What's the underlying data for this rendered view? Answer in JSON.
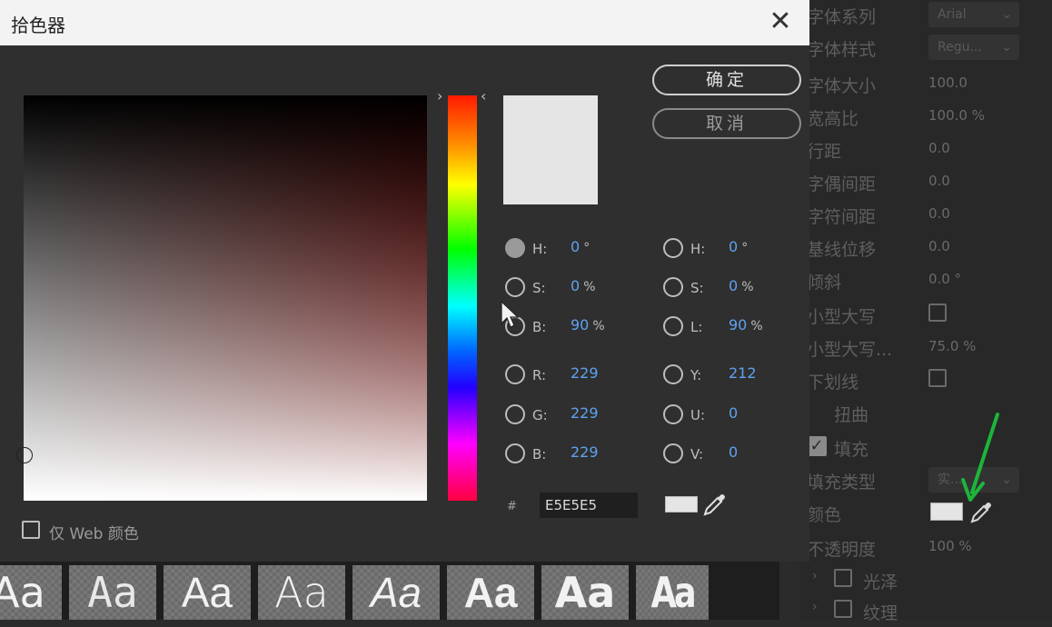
{
  "dialog": {
    "title": "拾色器",
    "close_glyph": "✕",
    "ok_label": "确定",
    "cancel_label": "取消",
    "hue_arrow_left": "›",
    "hue_arrow_right": "‹",
    "preview_color": "#e5e5e5",
    "fields_left": [
      {
        "label": "H:",
        "value": "0",
        "unit": "°",
        "selected": true
      },
      {
        "label": "S:",
        "value": "0",
        "unit": "%",
        "selected": false
      },
      {
        "label": "B:",
        "value": "90",
        "unit": "%",
        "selected": false
      },
      {
        "label": "R:",
        "value": "229",
        "unit": "",
        "selected": false
      },
      {
        "label": "G:",
        "value": "229",
        "unit": "",
        "selected": false
      },
      {
        "label": "B:",
        "value": "229",
        "unit": "",
        "selected": false
      }
    ],
    "fields_right": [
      {
        "label": "H:",
        "value": "0",
        "unit": "°",
        "selected": false
      },
      {
        "label": "S:",
        "value": "0",
        "unit": "%",
        "selected": false
      },
      {
        "label": "L:",
        "value": "90",
        "unit": "%",
        "selected": false
      },
      {
        "label": "Y:",
        "value": "212",
        "unit": "",
        "selected": false
      },
      {
        "label": "U:",
        "value": "0",
        "unit": "",
        "selected": false
      },
      {
        "label": "V:",
        "value": "0",
        "unit": "",
        "selected": false
      }
    ],
    "hash": "#",
    "hex_value": "E5E5E5",
    "web_only_label": "仅 Web 颜色"
  },
  "properties": {
    "rows": [
      {
        "label": "字体系列",
        "dropdown": "Arial"
      },
      {
        "label": "字体样式",
        "dropdown": "Regu..."
      },
      {
        "label": "字体大小",
        "value": "100.0"
      },
      {
        "label": "宽高比",
        "value": "100.0 %"
      },
      {
        "label": "行距",
        "value": "0.0"
      },
      {
        "label": "字偶间距",
        "value": "0.0"
      },
      {
        "label": "字符间距",
        "value": "0.0"
      },
      {
        "label": "基线位移",
        "value": "0.0"
      },
      {
        "label": "倾斜",
        "value": "0.0 °"
      },
      {
        "label": "小型大写",
        "checkbox": true
      },
      {
        "label": "小型大写...",
        "value": "75.0 %"
      },
      {
        "label": "下划线",
        "checkbox": true
      },
      {
        "label": "扭曲"
      },
      {
        "label": "填充"
      },
      {
        "label": "填充类型",
        "dropdown": "实..."
      },
      {
        "label": "颜色"
      },
      {
        "label": "不透明度",
        "value": "100 %"
      },
      {
        "label": "光泽"
      },
      {
        "label": "纹理"
      }
    ],
    "fill_color": "#e5e5e5",
    "arrow_color": "#1db53a"
  },
  "font_previews": [
    "Aa",
    "Aa",
    "Aa",
    "Aa",
    "Aa",
    "Aa",
    "Aa",
    "Aa"
  ]
}
